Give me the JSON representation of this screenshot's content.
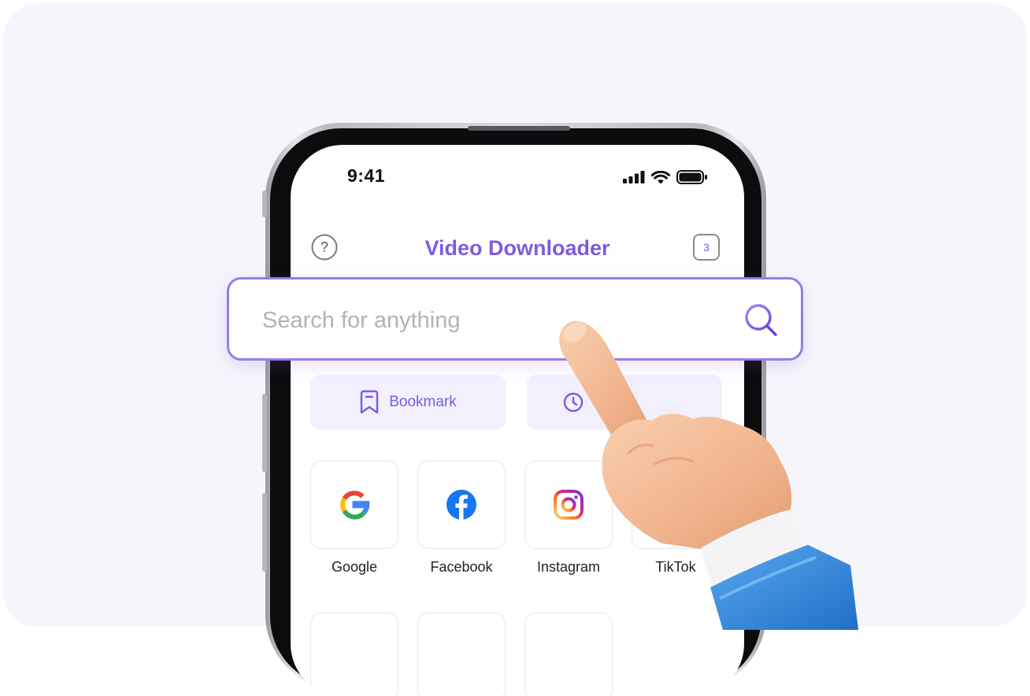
{
  "status_bar": {
    "time": "9:41"
  },
  "header": {
    "title": "Video Downloader",
    "tab_count": "3"
  },
  "search": {
    "placeholder": "Search for anything"
  },
  "quick_actions": [
    {
      "label": "Bookmark",
      "icon": "bookmark-icon"
    },
    {
      "label": "",
      "icon": "history-icon"
    }
  ],
  "sites": [
    {
      "label": "Google",
      "icon": "google-icon"
    },
    {
      "label": "Facebook",
      "icon": "facebook-icon"
    },
    {
      "label": "Instagram",
      "icon": "instagram-icon"
    },
    {
      "label": "TikTok",
      "icon": "tiktok-icon"
    }
  ],
  "colors": {
    "accent": "#7f5ae0",
    "background": "#f6f5fc",
    "facebook": "#1877f2"
  }
}
